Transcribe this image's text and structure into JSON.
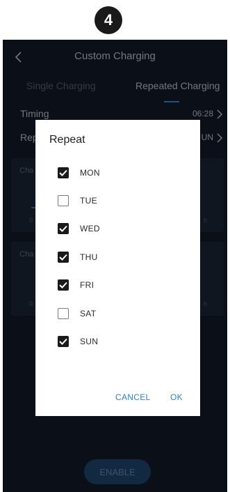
{
  "step_badge": "4",
  "header": {
    "title": "Custom Charging",
    "back_icon": "chevron-left-icon"
  },
  "tabs": [
    {
      "label": "Single Charging",
      "active": false
    },
    {
      "label": "Repeated Charging",
      "active": true
    }
  ],
  "settings": {
    "timing": {
      "label": "Timing",
      "value": "06:28"
    },
    "repeat": {
      "label": "Rep",
      "value": "UN"
    }
  },
  "cards": [
    {
      "label": "Cha",
      "tick_left": "0",
      "tick_right": "h"
    },
    {
      "label": "Cha",
      "tick_left": "0",
      "tick_right": "h"
    }
  ],
  "enable_button": "ENABLE",
  "dialog": {
    "title": "Repeat",
    "days": [
      {
        "label": "MON",
        "checked": true
      },
      {
        "label": "TUE",
        "checked": false
      },
      {
        "label": "WED",
        "checked": true
      },
      {
        "label": "THU",
        "checked": true
      },
      {
        "label": "FRI",
        "checked": true
      },
      {
        "label": "SAT",
        "checked": false
      },
      {
        "label": "SUN",
        "checked": true
      }
    ],
    "cancel_label": "CANCEL",
    "ok_label": "OK"
  },
  "colors": {
    "accent": "#2f7fd6",
    "background": "#111a26",
    "dialog": "#ffffff"
  }
}
